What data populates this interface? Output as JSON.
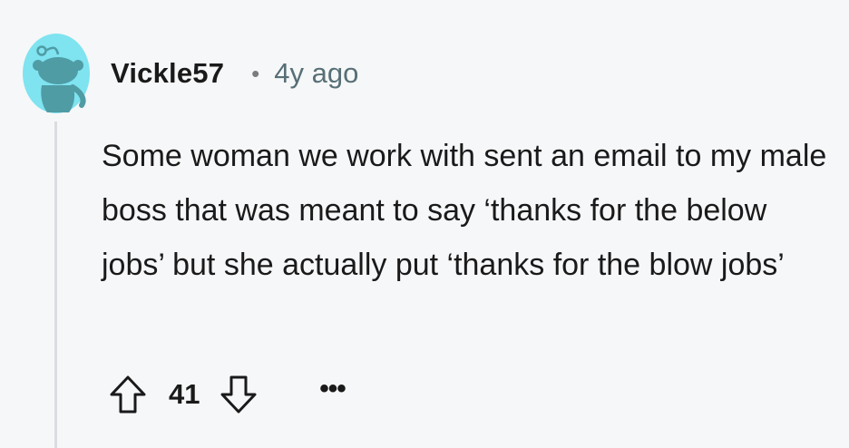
{
  "comment": {
    "author": "Vickle57",
    "separator": "•",
    "age": "4y ago",
    "body": "Some woman we work with sent an email to my male boss that was meant to say ‘thanks for the below jobs’ but she actually put ‘thanks for the blow jobs’",
    "score": "41",
    "more_label": "•••"
  },
  "icons": {
    "avatar": "snoo-avatar-icon",
    "upvote": "arrow-up-icon",
    "downvote": "arrow-down-icon",
    "more": "more-options-icon"
  },
  "colors": {
    "background": "#f6f7f8",
    "avatar_bg": "#7fe3f0",
    "avatar_figure": "#4f9ca5",
    "thread_line": "#dadce0",
    "meta_text": "#576f76"
  }
}
